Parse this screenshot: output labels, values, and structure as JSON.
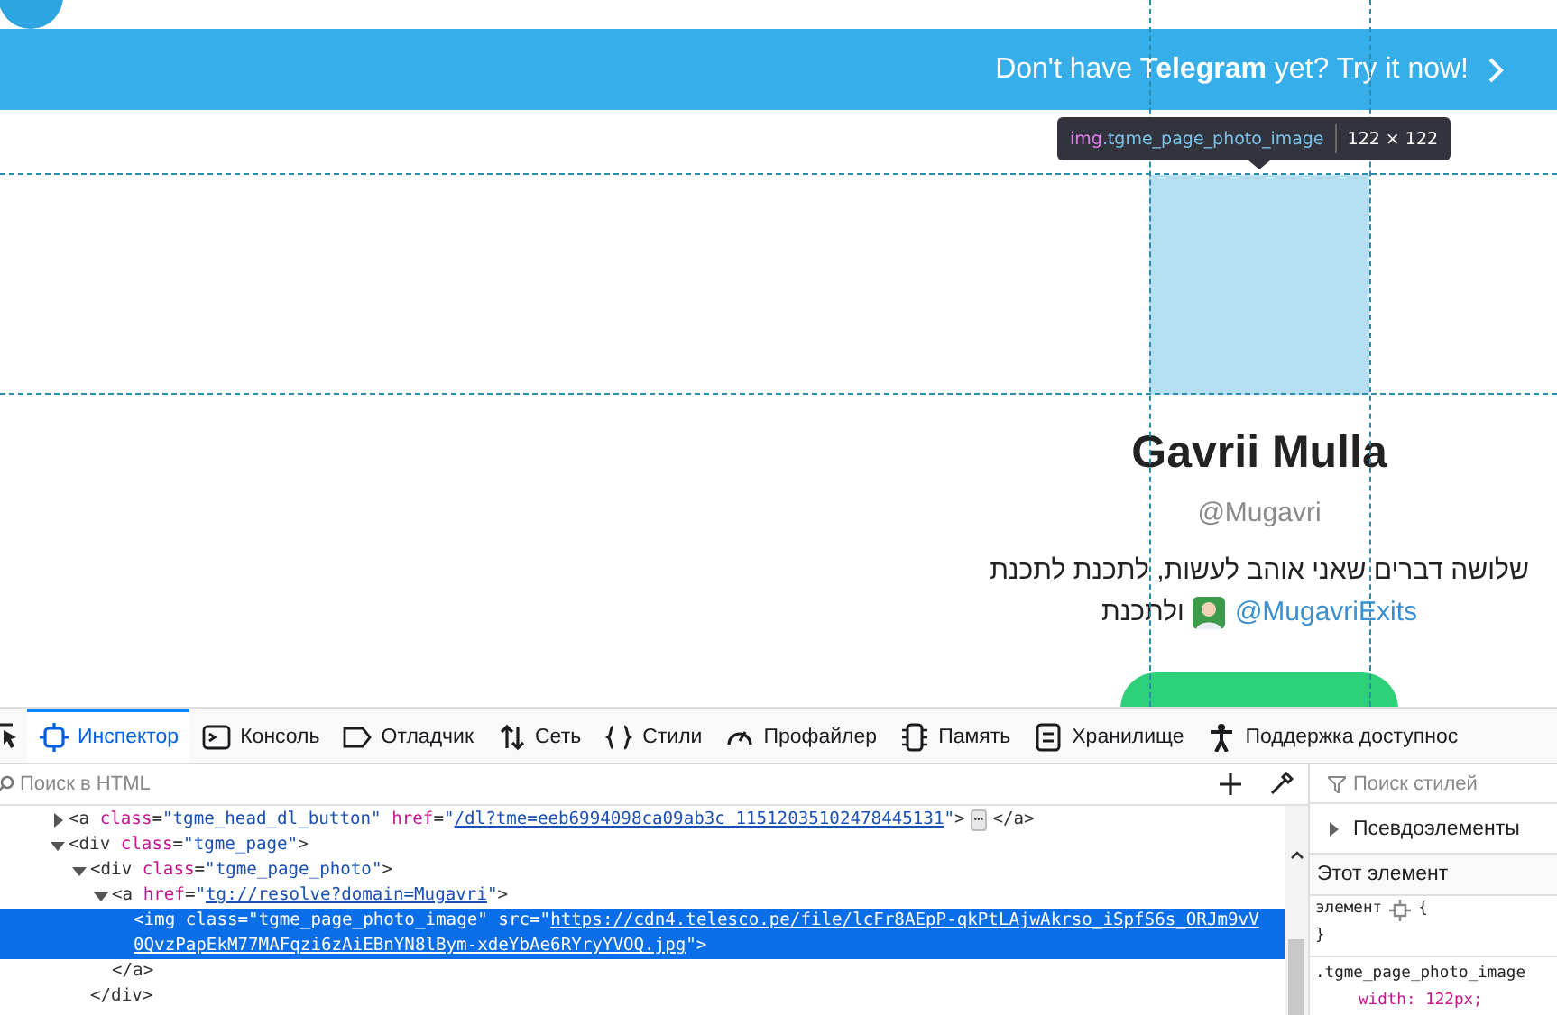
{
  "page": {
    "banner": {
      "text": "Don't have **Telegram** yet? Try it now!"
    },
    "profile": {
      "name": "Gavrii Mulla",
      "handle": "@Mugavri",
      "bio_line": "שלושה דברים שאני אוהב לעשות, לתכנת לתכנת",
      "bio_tail": "ולתכנת",
      "bio_link": "@MugavriExits"
    }
  },
  "highlight_tooltip": {
    "tag": "img",
    "class": ".tgme_page_photo_image",
    "size": "122 × 122"
  },
  "devtools": {
    "tabs": [
      {
        "label": "Инспектор",
        "selected": true,
        "kind": "inspector"
      },
      {
        "label": "Консоль",
        "selected": false,
        "kind": "console"
      },
      {
        "label": "Отладчик",
        "selected": false,
        "kind": "debugger"
      },
      {
        "label": "Сеть",
        "selected": false,
        "kind": "network"
      },
      {
        "label": "Стили",
        "selected": false,
        "kind": "styles"
      },
      {
        "label": "Профайлер",
        "selected": false,
        "kind": "profiler"
      },
      {
        "label": "Память",
        "selected": false,
        "kind": "memory"
      },
      {
        "label": "Хранилище",
        "selected": false,
        "kind": "storage"
      },
      {
        "label": "Поддержка доступнос",
        "selected": false,
        "kind": "accessibility"
      }
    ],
    "html_search": {
      "placeholder": "Поиск в HTML"
    },
    "markup": [
      {
        "expanded": false,
        "selected": false,
        "tokens": [
          {
            "kind": "tag",
            "text": "<a"
          },
          {
            "kind": "attr",
            "text": " class"
          },
          {
            "kind": "punct",
            "text": "="
          },
          {
            "kind": "value",
            "text": "\"tgme_head_dl_button\""
          },
          {
            "kind": "attr",
            "text": " href"
          },
          {
            "kind": "punct",
            "text": "="
          },
          {
            "kind": "value",
            "text": "\""
          },
          {
            "kind": "link",
            "text": "/dl?tme=eeb6994098ca09ab3c_11512035102478445131"
          },
          {
            "kind": "value",
            "text": "\""
          },
          {
            "kind": "tag",
            "text": ">"
          },
          {
            "kind": "badge",
            "text": "⋯"
          },
          {
            "kind": "tag",
            "text": "</a>"
          }
        ]
      },
      {
        "expanded": true,
        "selected": false,
        "tokens": [
          {
            "kind": "tag",
            "text": "<div"
          },
          {
            "kind": "attr",
            "text": " class"
          },
          {
            "kind": "punct",
            "text": "="
          },
          {
            "kind": "value",
            "text": "\"tgme_page\""
          },
          {
            "kind": "tag",
            "text": ">"
          }
        ],
        "children": [
          {
            "expanded": true,
            "selected": false,
            "tokens": [
              {
                "kind": "tag",
                "text": "<div"
              },
              {
                "kind": "attr",
                "text": " class"
              },
              {
                "kind": "punct",
                "text": "="
              },
              {
                "kind": "value",
                "text": "\"tgme_page_photo\""
              },
              {
                "kind": "tag",
                "text": ">"
              }
            ],
            "close": "</div>",
            "children": [
              {
                "expanded": true,
                "selected": false,
                "tokens": [
                  {
                    "kind": "tag",
                    "text": "<a"
                  },
                  {
                    "kind": "attr",
                    "text": " href"
                  },
                  {
                    "kind": "punct",
                    "text": "="
                  },
                  {
                    "kind": "value",
                    "text": "\""
                  },
                  {
                    "kind": "link",
                    "text": "tg://resolve?domain=Mugavri"
                  },
                  {
                    "kind": "value",
                    "text": "\""
                  },
                  {
                    "kind": "tag",
                    "text": ">"
                  }
                ],
                "close": "</a>",
                "children": [
                  {
                    "selected": true,
                    "tokens": [
                      {
                        "kind": "tag",
                        "text": "<img"
                      },
                      {
                        "kind": "attr",
                        "text": " class"
                      },
                      {
                        "kind": "punct",
                        "text": "="
                      },
                      {
                        "kind": "value",
                        "text": "\"tgme_page_photo_image\""
                      },
                      {
                        "kind": "attr",
                        "text": " src"
                      },
                      {
                        "kind": "punct",
                        "text": "="
                      },
                      {
                        "kind": "value",
                        "text": "\""
                      },
                      {
                        "kind": "link",
                        "text": "https://cdn4.telesco.pe/file/lcFr8AEpP-qkPtLAjwAkrso_iSpfS6s_ORJm9vV0QvzPapEkM77MAFqzi6zAiEBnYN8lBym-xdeYbAe6RYryYVOQ.jpg"
                      },
                      {
                        "kind": "value",
                        "text": "\""
                      },
                      {
                        "kind": "tag",
                        "text": ">"
                      }
                    ]
                  }
                ]
              }
            ]
          }
        ]
      }
    ],
    "styles_search": {
      "placeholder": "Поиск стилей"
    },
    "pseudo_elements": {
      "label": "Псевдоэлементы",
      "expanded": false
    },
    "this_element": {
      "label": "Этот элемент"
    },
    "rules": [
      {
        "selector": "элемент",
        "open": "{",
        "close": "}",
        "kind": "element"
      },
      {
        "selector": ".tgme_page_photo_image",
        "declaration": "width: 122px;",
        "kind": "class"
      }
    ]
  }
}
